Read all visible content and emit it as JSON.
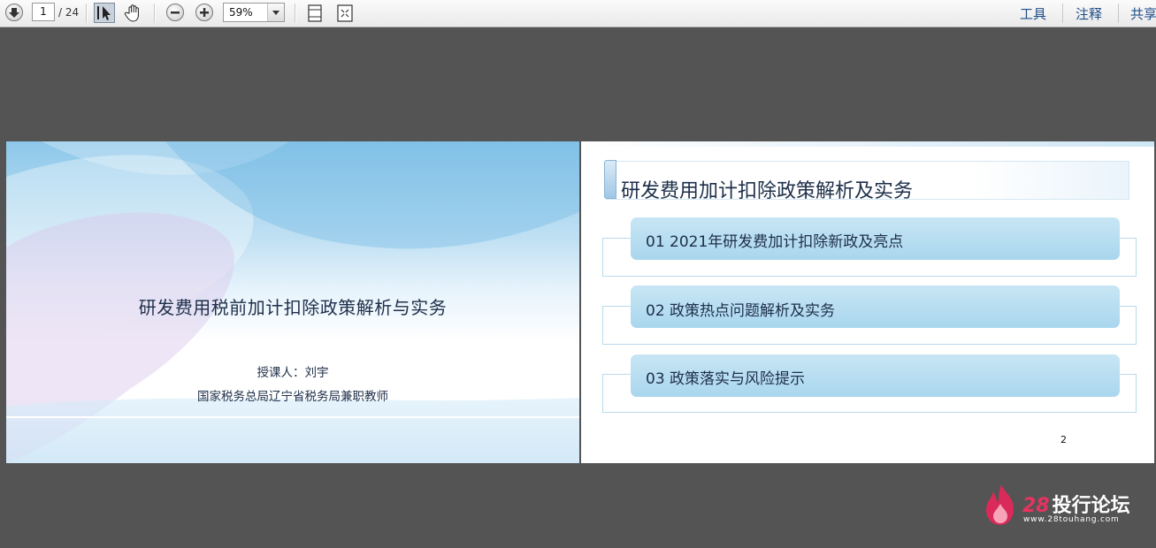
{
  "toolbar": {
    "page_current": "1",
    "page_total": "/ 24",
    "zoom": "59%",
    "menu": [
      "工具",
      "注释",
      "共享"
    ]
  },
  "slide1": {
    "title": "研发费用税前加计扣除政策解析与实务",
    "lecturer": "授课人：刘宇",
    "affiliation": "国家税务总局辽宁省税务局兼职教师"
  },
  "slide2": {
    "title": "研发费用加计扣除政策解析及实务",
    "items": [
      "01 2021年研发费加计扣除新政及亮点",
      "02 政策热点问题解析及实务",
      "03 政策落实与风险提示"
    ],
    "page_number": "2"
  },
  "watermark": {
    "num": "28",
    "name": "投行论坛",
    "url": "www.28touhang.com"
  },
  "colors": {
    "viewer_bg": "#545454",
    "accent_pill": "#b3dcf0",
    "text_dark": "#1e2f4a",
    "menu_link": "#1f4e88",
    "logo_red": "#e8325f"
  }
}
